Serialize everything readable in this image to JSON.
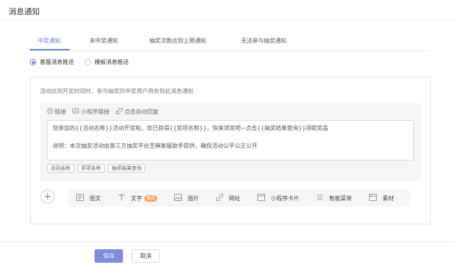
{
  "page": {
    "title": "消息通知"
  },
  "tabs": [
    {
      "label": "中奖通知",
      "active": true
    },
    {
      "label": "未中奖通知",
      "active": false
    },
    {
      "label": "抽奖次数达到上限通知",
      "active": false
    },
    {
      "label": "无法参与抽奖通知",
      "active": false
    }
  ],
  "push_mode": {
    "options": [
      {
        "label": "客服消息推送",
        "checked": true
      },
      {
        "label": "模板消息推送",
        "checked": false
      }
    ]
  },
  "panel": {
    "hint": "活动达到开奖时间时，参与抽奖的中奖用户将收到此消息通知",
    "toolbar": [
      {
        "label": "链接",
        "icon": "link-icon"
      },
      {
        "label": "小程序链接",
        "icon": "miniprogram-icon"
      },
      {
        "label": "点击自动回复",
        "icon": "reply-link-icon"
      }
    ],
    "message_lines": [
      "您参加的{{活动名称}}活动开奖啦，您已获得{{奖项名称}}，快来领奖吧~点击{{抽奖结果查询}}领取奖品",
      "说明：本次抽奖活动由第三方抽奖平台芝麻客服助手提供，确保活动公平公正公开"
    ],
    "variable_chips": [
      "活动名称",
      "奖项名称",
      "抽奖结果查询"
    ],
    "message_types": [
      {
        "label": "图文",
        "icon": "news-icon"
      },
      {
        "label": "文字",
        "icon": "text-icon",
        "badge": "激活"
      },
      {
        "label": "图片",
        "icon": "image-icon"
      },
      {
        "label": "网址",
        "icon": "url-icon"
      },
      {
        "label": "小程序卡片",
        "icon": "miniprogram-card-icon"
      },
      {
        "label": "智能菜单",
        "icon": "menu-icon"
      },
      {
        "label": "素材",
        "icon": "material-icon"
      }
    ],
    "add_symbol": "+"
  },
  "footer": {
    "save_label": "保存",
    "cancel_label": "取消"
  },
  "colors": {
    "accent": "#6b7bd6",
    "primary_button": "#7b8be0",
    "badge": "#f5a25d"
  }
}
